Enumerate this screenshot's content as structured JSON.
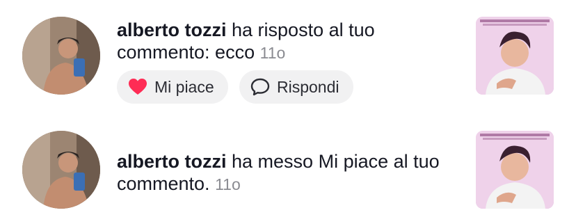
{
  "notifications": [
    {
      "user": "alberto tozzi",
      "action": " ha risposto al tuo commento: ecco",
      "time": "11o",
      "buttons": {
        "like_label": "Mi piace",
        "reply_label": "Rispondi"
      },
      "avatar_icon": "user-avatar",
      "thumbnail_icon": "video-thumbnail"
    },
    {
      "user": "alberto tozzi",
      "action": " ha messo Mi piace al tuo commento.",
      "time": "11o",
      "avatar_icon": "user-avatar",
      "thumbnail_icon": "video-thumbnail"
    }
  ],
  "colors": {
    "like_heart": "#fe2c55",
    "time_gray": "#8a8b91",
    "pill_bg": "#f1f1f2"
  }
}
